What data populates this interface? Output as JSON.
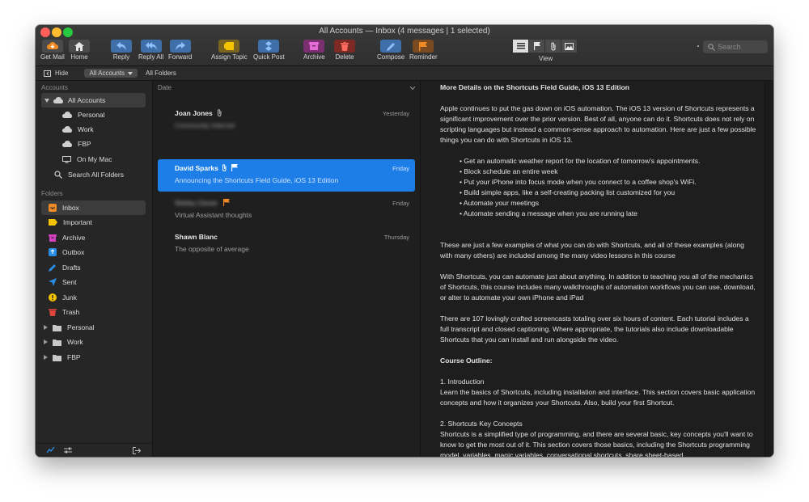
{
  "window": {
    "title": "All Accounts — Inbox (4 messages | 1 selected)"
  },
  "toolbar": {
    "buttons": [
      {
        "label": "Get Mail",
        "icon": "get-mail-icon"
      },
      {
        "label": "Home",
        "icon": "home-icon"
      },
      {
        "label": "Reply",
        "icon": "reply-icon"
      },
      {
        "label": "Reply All",
        "icon": "reply-all-icon"
      },
      {
        "label": "Forward",
        "icon": "forward-icon"
      },
      {
        "label": "Assign Topic",
        "icon": "tag-icon"
      },
      {
        "label": "Quick Post",
        "icon": "quick-post-icon"
      },
      {
        "label": "Archive",
        "icon": "archive-icon"
      },
      {
        "label": "Delete",
        "icon": "trash-icon"
      },
      {
        "label": "Compose",
        "icon": "compose-icon"
      },
      {
        "label": "Reminder",
        "icon": "flag-icon"
      }
    ],
    "view_label": "View",
    "search_placeholder": "Search"
  },
  "subbar": {
    "hide": "Hide",
    "all_accounts": "All Accounts",
    "all_folders": "All Folders"
  },
  "sidebar": {
    "accounts_label": "Accounts",
    "accounts": [
      {
        "label": "All Accounts"
      },
      {
        "label": "Personal"
      },
      {
        "label": "Work"
      },
      {
        "label": "FBP"
      },
      {
        "label": "On My Mac"
      },
      {
        "label": "Search All Folders"
      }
    ],
    "folders_label": "Folders",
    "folders": [
      {
        "label": "Inbox",
        "color": "#f08a24"
      },
      {
        "label": "Important",
        "color": "#f5c400"
      },
      {
        "label": "Archive",
        "color": "#d23fbf"
      },
      {
        "label": "Outbox",
        "color": "#2a8de6"
      },
      {
        "label": "Drafts",
        "color": "#2a8de6"
      },
      {
        "label": "Sent",
        "color": "#2a8de6"
      },
      {
        "label": "Junk",
        "color": "#f5c400"
      },
      {
        "label": "Trash",
        "color": "#e0463c"
      },
      {
        "label": "Personal",
        "color": "#c9c9c9"
      },
      {
        "label": "Work",
        "color": "#c9c9c9"
      },
      {
        "label": "FBP",
        "color": "#c9c9c9"
      }
    ]
  },
  "list": {
    "sort_label": "Date",
    "messages": [
      {
        "from": "Joan Jones",
        "date": "Yesterday",
        "subject": "Community Internet"
      },
      {
        "from": "David Sparks",
        "date": "Friday",
        "subject": "Announcing the Shortcuts Field Guide, iOS 13 Edition"
      },
      {
        "from": "Shirley Clover",
        "date": "Friday",
        "subject": "Virtual Assistant thoughts"
      },
      {
        "from": "Shawn Blanc",
        "date": "Thursday",
        "subject": "The opposite of average"
      }
    ]
  },
  "reader": {
    "heading": "More Details on the Shortcuts Field Guide, iOS 13 Edition",
    "p1": "Apple continues to put the gas down on iOS automation. The iOS 13 version of Shortcuts represents a significant improvement over the prior version. Best of all, anyone can do it. Shortcuts does not rely on scripting languages but instead a common-sense approach to automation. Here are just a few possible things you can do with Shortcuts in iOS 13.",
    "bullets": [
      "Get an automatic weather report for the location of tomorrow's appointments.",
      "Block schedule an entire week",
      "Put your iPhone into focus mode when you connect to a coffee shop's WiFi.",
      "Build simple apps, like a self-creating packing list customized for you",
      "Automate your meetings",
      "Automate sending a message when you are running late"
    ],
    "p2": "These are just a few examples of what you can do with Shortcuts, and all of these examples (along with many others) are included among the many video lessons in this course",
    "p3": "With Shortcuts, you can automate just about anything. In addition to teaching you all of the mechanics of Shortcuts, this course includes many walkthroughs of automation workflows you can use, download, or alter to automate your own iPhone and iPad",
    "p4": "There are 107 lovingly crafted screencasts totaling over six hours of content. Each tutorial includes a full transcript and closed captioning. Where appropriate, the tutorials also include downloadable Shortcuts that you can install and run alongside the video.",
    "outline_heading": "Course Outline:",
    "s1_title": "1. Introduction",
    "s1_body": "Learn the basics of Shortcuts, including installation and interface. This section covers basic application concepts and how it organizes your Shortcuts. Also, build your first Shortcut.",
    "s2_title": "2. Shortcuts Key Concepts",
    "s2_body": "Shortcuts is a simplified type of programming, and there are several basic, key concepts you'll want to know to get the most out of it. This section covers those basics, including the Shortcuts programming model, variables, magic variables, conversational shortcuts, share sheet-based"
  }
}
